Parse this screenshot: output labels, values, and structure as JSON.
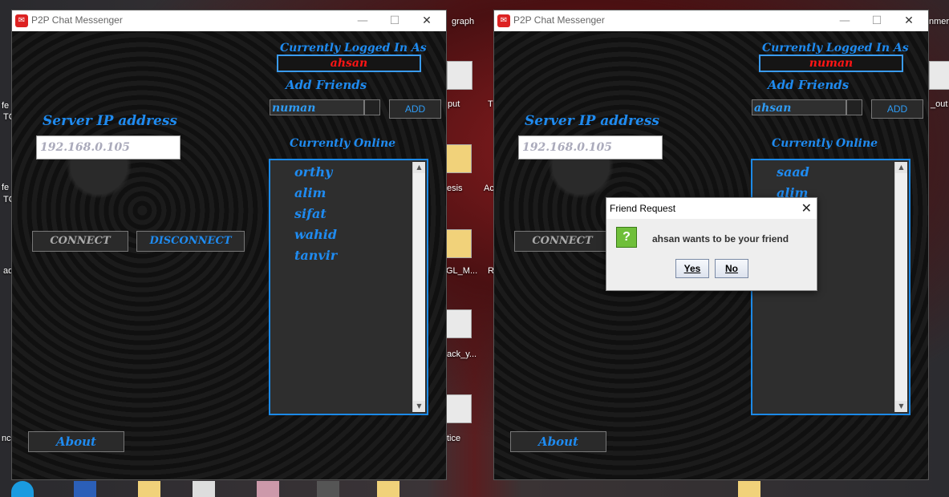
{
  "desktop": {
    "labels": [
      "graph",
      "nmer",
      "fe",
      "TC",
      "put",
      "T",
      "_out",
      "esis",
      "Ac",
      "fe",
      "TC",
      "GL_M...",
      "R",
      "ad",
      "ack_y...",
      "tice",
      "nc"
    ]
  },
  "windows": [
    {
      "title": "P2P Chat Messenger",
      "logged_in_label": "Currently Logged In As",
      "logged_in_user": "ahsan",
      "add_friends_label": "Add Friends",
      "friend_input_value": "numan",
      "add_button": "ADD",
      "server_ip_label": "Server IP address",
      "server_ip_placeholder": "192.168.0.105",
      "currently_online_label": "Currently Online",
      "online_users": [
        "orthy",
        "alim",
        "sifat",
        "wahid",
        "tanvir"
      ],
      "connect_button": "CONNECT",
      "disconnect_button": "DISCONNECT",
      "about_button": "About",
      "controls": {
        "minimize": "—",
        "maximize": "☐",
        "close": "✕"
      }
    },
    {
      "title": "P2P Chat Messenger",
      "logged_in_label": "Currently Logged In As",
      "logged_in_user": "numan",
      "add_friends_label": "Add Friends",
      "friend_input_value": "ahsan",
      "add_button": "ADD",
      "server_ip_label": "Server IP address",
      "server_ip_placeholder": "192.168.0.105",
      "currently_online_label": "Currently Online",
      "online_users": [
        "saad",
        "alim"
      ],
      "connect_button": "CONNECT",
      "about_button": "About",
      "controls": {
        "minimize": "—",
        "maximize": "☐",
        "close": "✕"
      }
    }
  ],
  "dialog": {
    "title": "Friend Request",
    "message": "ahsan wants to be your friend",
    "icon": "question-icon",
    "yes": "Yes",
    "no": "No",
    "close": "✕"
  },
  "colors": {
    "accent": "#1f8bf0",
    "user": "#ff1515"
  }
}
